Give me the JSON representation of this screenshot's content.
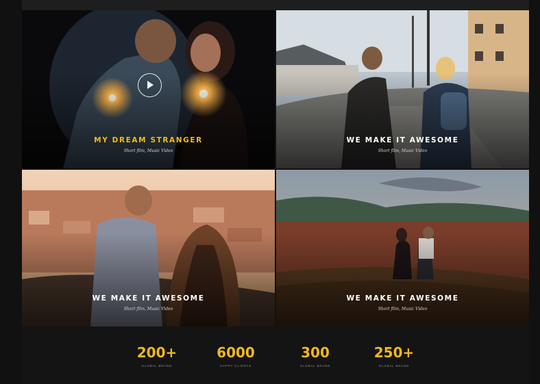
{
  "colors": {
    "accent": "#f2b81d",
    "background": "#111111",
    "caption": "#ffffff"
  },
  "gallery": {
    "tiles": [
      {
        "title": "MY DREAM STRANGER",
        "subtitle": "Short film, Music Video",
        "has_play": true,
        "title_color": "#f2b81d",
        "icon": "play-icon"
      },
      {
        "title": "WE MAKE IT AWESOME",
        "subtitle": "Short film, Music Video",
        "has_play": false,
        "title_color": "#ffffff"
      },
      {
        "title": "WE MAKE IT AWESOME",
        "subtitle": "Short film, Music Video",
        "has_play": false,
        "title_color": "#ffffff"
      },
      {
        "title": "WE MAKE IT AWESOME",
        "subtitle": "Short film, Music Video",
        "has_play": false,
        "title_color": "#ffffff"
      }
    ]
  },
  "stats": [
    {
      "value": "200+",
      "label": "GLOBAL BRAND"
    },
    {
      "value": "6000",
      "label": "HAPPY CLIENTS"
    },
    {
      "value": "300",
      "label": "GLOBAL BRAND"
    },
    {
      "value": "250+",
      "label": "GLOBAL BRAND"
    }
  ]
}
